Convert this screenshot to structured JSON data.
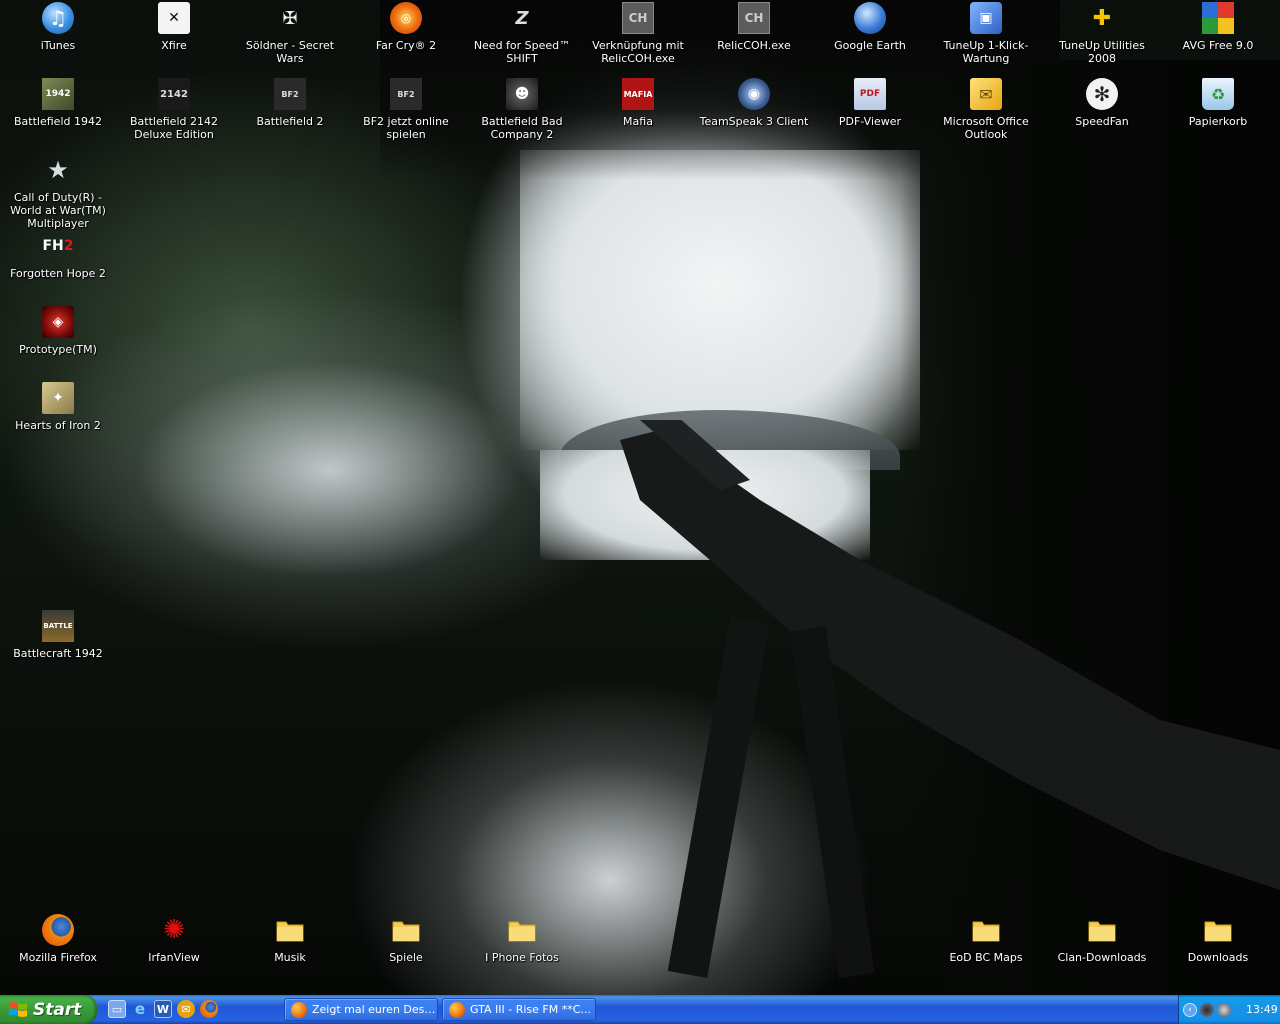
{
  "desktop_icons": [
    {
      "label": "iTunes",
      "icon": "itunes-icon"
    },
    {
      "label": "Xfire",
      "icon": "xfire-icon"
    },
    {
      "label": "Söldner - Secret Wars",
      "icon": "soldner-icon"
    },
    {
      "label": "Far Cry® 2",
      "icon": "farcry-icon"
    },
    {
      "label": "Need for Speed™ SHIFT",
      "icon": "nfs-icon"
    },
    {
      "label": "Verknüpfung mit RelicCOH.exe",
      "icon": "coh-icon"
    },
    {
      "label": "RelicCOH.exe",
      "icon": "coh-icon"
    },
    {
      "label": "Google Earth",
      "icon": "google-earth-icon"
    },
    {
      "label": "TuneUp 1-Klick-Wartung",
      "icon": "tuneup-icon"
    },
    {
      "label": "TuneUp Utilities 2008",
      "icon": "tuneup-utilities-icon"
    },
    {
      "label": "AVG Free 9.0",
      "icon": "avg-icon"
    },
    {
      "label": "Battlefield 1942",
      "icon": "bf1942-icon"
    },
    {
      "label": "Battlefield 2142 Deluxe Edition",
      "icon": "bf2142-icon"
    },
    {
      "label": "Battlefield 2",
      "icon": "bf2-icon"
    },
    {
      "label": "BF2 jetzt online spielen",
      "icon": "bf2-online-icon"
    },
    {
      "label": "Battlefield Bad Company 2",
      "icon": "bfbc2-icon"
    },
    {
      "label": "Mafia",
      "icon": "mafia-icon"
    },
    {
      "label": "TeamSpeak 3 Client",
      "icon": "teamspeak-icon"
    },
    {
      "label": "PDF-Viewer",
      "icon": "pdf-icon"
    },
    {
      "label": "Microsoft Office Outlook",
      "icon": "outlook-icon"
    },
    {
      "label": "SpeedFan",
      "icon": "speedfan-icon"
    },
    {
      "label": "Papierkorb",
      "icon": "recycle-bin-icon"
    },
    {
      "label": "Call of Duty(R) - World at War(TM) Multiplayer",
      "icon": "cod-icon"
    },
    {
      "label": "Forgotten Hope 2",
      "icon": "fh2-icon"
    },
    {
      "label": "Prototype(TM)",
      "icon": "prototype-icon"
    },
    {
      "label": "Hearts of Iron 2",
      "icon": "hoi2-icon"
    },
    {
      "label": "Battlecraft 1942",
      "icon": "battlecraft-icon"
    },
    {
      "label": "Mozilla Firefox",
      "icon": "firefox-icon"
    },
    {
      "label": "IrfanView",
      "icon": "irfanview-icon"
    },
    {
      "label": "Musik",
      "icon": "folder-icon"
    },
    {
      "label": "Spiele",
      "icon": "folder-icon"
    },
    {
      "label": "I Phone Fotos",
      "icon": "folder-icon"
    },
    {
      "label": "EoD BC Maps",
      "icon": "folder-icon"
    },
    {
      "label": "Clan-Downloads",
      "icon": "folder-icon"
    },
    {
      "label": "Downloads",
      "icon": "folder-icon"
    }
  ],
  "taskbar": {
    "start_label": "Start",
    "quick_launch": [
      "show-desktop-icon",
      "internet-explorer-icon",
      "word-icon",
      "outlook-icon",
      "firefox-icon"
    ],
    "tasks": [
      {
        "label": "Zeigt mal euren Deskt...",
        "icon": "firefox-icon"
      },
      {
        "label": "GTA III - Rise FM **C...",
        "icon": "firefox-icon"
      }
    ],
    "tray": {
      "icons": [
        "tray-arrow-icon",
        "network-icon",
        "volume-icon"
      ],
      "clock": "13:49"
    }
  },
  "colors": {
    "taskbar_blue": "#2663e0",
    "start_green": "#379937",
    "tray_blue": "#1894e6"
  }
}
